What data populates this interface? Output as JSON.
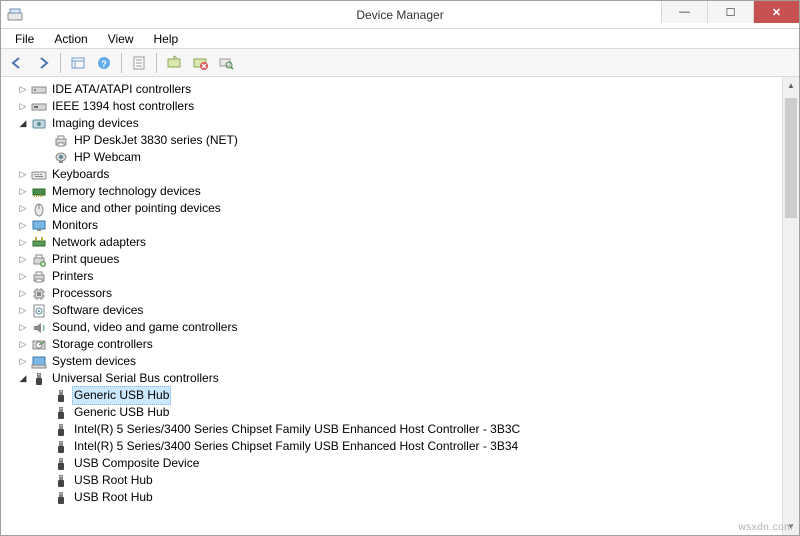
{
  "window": {
    "title": "Device Manager"
  },
  "menu": [
    "File",
    "Action",
    "View",
    "Help"
  ],
  "watermark": "wsxdn.com",
  "tree": [
    {
      "depth": 0,
      "exp": "closed",
      "icon": "ide",
      "label": "IDE ATA/ATAPI controllers"
    },
    {
      "depth": 0,
      "exp": "closed",
      "icon": "ieee1394",
      "label": "IEEE 1394 host controllers"
    },
    {
      "depth": 0,
      "exp": "open",
      "icon": "imaging",
      "label": "Imaging devices"
    },
    {
      "depth": 1,
      "exp": "none",
      "icon": "printer",
      "label": "HP DeskJet 3830 series (NET)"
    },
    {
      "depth": 1,
      "exp": "none",
      "icon": "webcam",
      "label": "HP Webcam"
    },
    {
      "depth": 0,
      "exp": "closed",
      "icon": "keyboard",
      "label": "Keyboards"
    },
    {
      "depth": 0,
      "exp": "closed",
      "icon": "memory",
      "label": "Memory technology devices"
    },
    {
      "depth": 0,
      "exp": "closed",
      "icon": "mouse",
      "label": "Mice and other pointing devices"
    },
    {
      "depth": 0,
      "exp": "closed",
      "icon": "monitor",
      "label": "Monitors"
    },
    {
      "depth": 0,
      "exp": "closed",
      "icon": "network",
      "label": "Network adapters"
    },
    {
      "depth": 0,
      "exp": "closed",
      "icon": "printq",
      "label": "Print queues"
    },
    {
      "depth": 0,
      "exp": "closed",
      "icon": "printer",
      "label": "Printers"
    },
    {
      "depth": 0,
      "exp": "closed",
      "icon": "cpu",
      "label": "Processors"
    },
    {
      "depth": 0,
      "exp": "closed",
      "icon": "software",
      "label": "Software devices"
    },
    {
      "depth": 0,
      "exp": "closed",
      "icon": "sound",
      "label": "Sound, video and game controllers"
    },
    {
      "depth": 0,
      "exp": "closed",
      "icon": "storage",
      "label": "Storage controllers"
    },
    {
      "depth": 0,
      "exp": "closed",
      "icon": "system",
      "label": "System devices"
    },
    {
      "depth": 0,
      "exp": "open",
      "icon": "usb",
      "label": "Universal Serial Bus controllers"
    },
    {
      "depth": 1,
      "exp": "none",
      "icon": "usb",
      "label": "Generic USB Hub",
      "selected": true
    },
    {
      "depth": 1,
      "exp": "none",
      "icon": "usb",
      "label": "Generic USB Hub"
    },
    {
      "depth": 1,
      "exp": "none",
      "icon": "usb",
      "label": "Intel(R) 5 Series/3400 Series Chipset Family USB Enhanced Host Controller - 3B3C"
    },
    {
      "depth": 1,
      "exp": "none",
      "icon": "usb",
      "label": "Intel(R) 5 Series/3400 Series Chipset Family USB Enhanced Host Controller - 3B34"
    },
    {
      "depth": 1,
      "exp": "none",
      "icon": "usb",
      "label": "USB Composite Device"
    },
    {
      "depth": 1,
      "exp": "none",
      "icon": "usb",
      "label": "USB Root Hub"
    },
    {
      "depth": 1,
      "exp": "none",
      "icon": "usb",
      "label": "USB Root Hub"
    }
  ]
}
